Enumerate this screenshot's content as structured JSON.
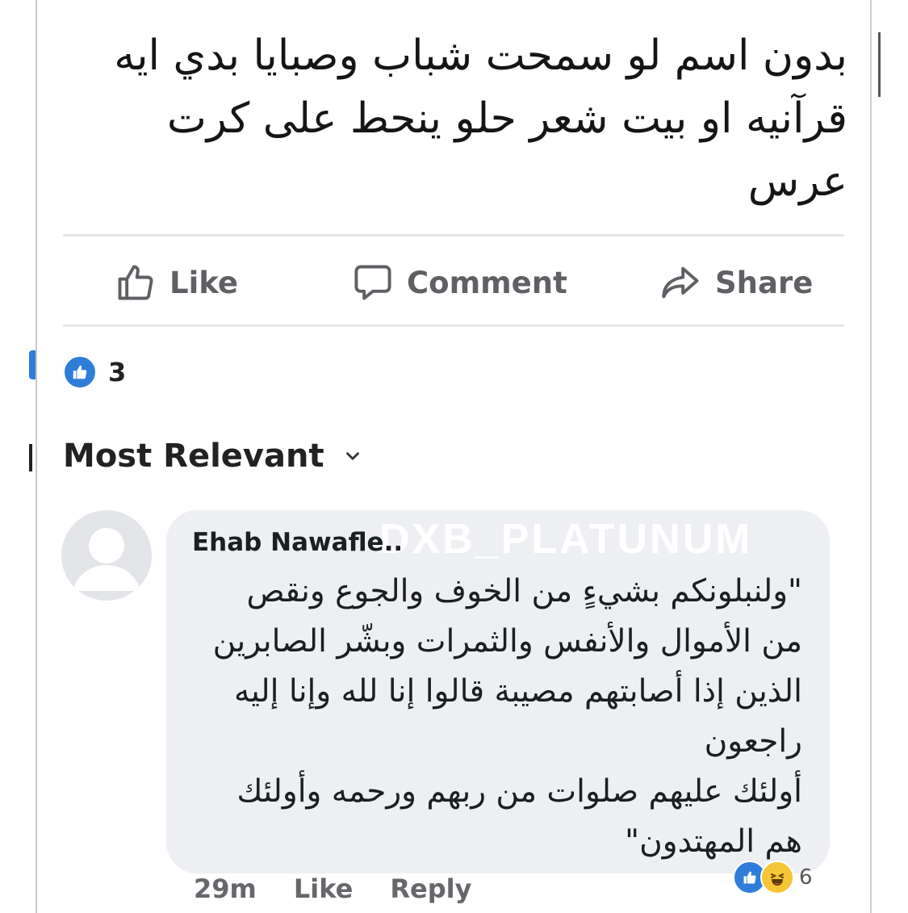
{
  "post": {
    "text": "بدون اسم لو سمحت شباب وصبايا بدي ايه قرآنيه او بيت شعر حلو ينحط على كرت عرس"
  },
  "actions": {
    "like_label": "Like",
    "comment_label": "Comment",
    "share_label": "Share"
  },
  "reactions": {
    "count": "3",
    "icon": "thumbs-up-icon",
    "color": "#2e7dd9"
  },
  "comments_sort": {
    "label": "Most Relevant",
    "icon": "chevron-down-icon"
  },
  "comment": {
    "author": "Ehab Nawafle..",
    "text": "\"ولنبلونكم بشيءٍ من الخوف والجوع ونقص\nمن الأموال والأنفس والثمرات وبشّر الصابرين\nالذين إذا أصابتهم مصيبة قالوا إنا لله وإنا إليه\nراجعون\nأولئك عليهم صلوات من ربهم ورحمه وأولئك\nهم المهتدون\"",
    "time": "29m",
    "like_label": "Like",
    "reply_label": "Reply",
    "reaction_count": "6",
    "reaction_icons": [
      "thumbs-up-icon",
      "haha-icon"
    ]
  },
  "watermark": "DXB_PLATUNUM"
}
